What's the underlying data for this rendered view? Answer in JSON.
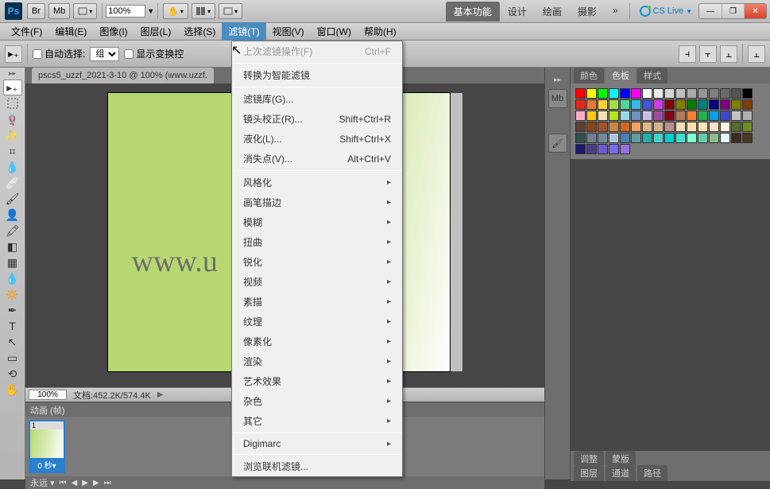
{
  "title_icons": {
    "br": "Br",
    "mb": "Mb"
  },
  "zoom": "100%",
  "workspaces": {
    "active": "基本功能",
    "w2": "设计",
    "w3": "绘画",
    "w4": "摄影",
    "more": "»"
  },
  "cslive": "CS Live",
  "menubar": {
    "file": "文件(F)",
    "edit": "编辑(E)",
    "image": "图像(I)",
    "layer": "图层(L)",
    "select": "选择(S)",
    "filter": "滤镜(T)",
    "view": "视图(V)",
    "window": "窗口(W)",
    "help": "帮助(H)"
  },
  "options": {
    "autoselect": "自动选择:",
    "group": "组",
    "showtransform": "显示变换控"
  },
  "doc_tab": "pscs5_uzzf_2021-3-10 @ 100% (www.uzzf.",
  "watermark": "www.u",
  "status": {
    "zoom": "100%",
    "doc": "文档:452.2K/574.4K"
  },
  "anim": {
    "title": "动画 (帧)",
    "frame_num": "1",
    "frame_time": "0 秒▾",
    "forever": "永远"
  },
  "panels": {
    "color": "颜色",
    "swatch": "色板",
    "style": "样式",
    "adjust": "调整",
    "mask": "蒙版",
    "layer": "图层",
    "channel": "通道",
    "path": "路径"
  },
  "filter_menu": {
    "last": "上次滤镜操作(F)",
    "last_sc": "Ctrl+F",
    "smart": "转换为智能滤镜",
    "gallery": "滤镜库(G)...",
    "lens": "镜头校正(R)...",
    "lens_sc": "Shift+Ctrl+R",
    "liquify": "液化(L)...",
    "liquify_sc": "Shift+Ctrl+X",
    "vanish": "消失点(V)...",
    "vanish_sc": "Alt+Ctrl+V",
    "stylize": "风格化",
    "brush": "画笔描边",
    "blur": "模糊",
    "distort": "扭曲",
    "sharpen": "锐化",
    "video": "视频",
    "sketch": "素描",
    "texture": "纹理",
    "pixelate": "像素化",
    "render": "渲染",
    "artistic": "艺术效果",
    "noise": "杂色",
    "other": "其它",
    "digimarc": "Digimarc",
    "browse": "浏览联机滤镜..."
  },
  "swatch_colors": [
    "#ff0000",
    "#ffff00",
    "#00ff00",
    "#00ffff",
    "#0000ff",
    "#ff00ff",
    "#ffffff",
    "#ebebeb",
    "#d6d6d6",
    "#c0c0c0",
    "#aaaaaa",
    "#959595",
    "#7f7f7f",
    "#6a6a6a",
    "#555555",
    "#000000",
    "#e6261f",
    "#eb7532",
    "#f7d038",
    "#a3e048",
    "#49da9a",
    "#34bbe6",
    "#4355db",
    "#d23be7",
    "#800000",
    "#808000",
    "#008000",
    "#008080",
    "#000080",
    "#800080",
    "#7f7f00",
    "#7f3f00",
    "#ffaec9",
    "#ffc90e",
    "#efe4b0",
    "#b5e61d",
    "#99d9ea",
    "#7092be",
    "#c8bfe7",
    "#a349a4",
    "#880015",
    "#b97a57",
    "#ff7f27",
    "#22b14c",
    "#00a2e8",
    "#3f48cc",
    "#c3c3c3",
    "#b0b0b0",
    "#5c4033",
    "#8b4513",
    "#a0522d",
    "#cd853f",
    "#d2691e",
    "#f4a460",
    "#deb887",
    "#d2b48c",
    "#bc8f8f",
    "#f5deb3",
    "#ffdead",
    "#ffe4b5",
    "#ffe4c4",
    "#fff8dc",
    "#556b2f",
    "#6b8e23",
    "#2f4f4f",
    "#708090",
    "#778899",
    "#b0c4de",
    "#4682b4",
    "#5f9ea0",
    "#20b2aa",
    "#48d1cc",
    "#00ced1",
    "#40e0d0",
    "#7fffd4",
    "#66cdaa",
    "#8fbc8f",
    "#e0ffff",
    "#3d2b1f",
    "#4b3621",
    "#191970",
    "#483d8b",
    "#6a5acd",
    "#7b68ee",
    "#9370db"
  ]
}
